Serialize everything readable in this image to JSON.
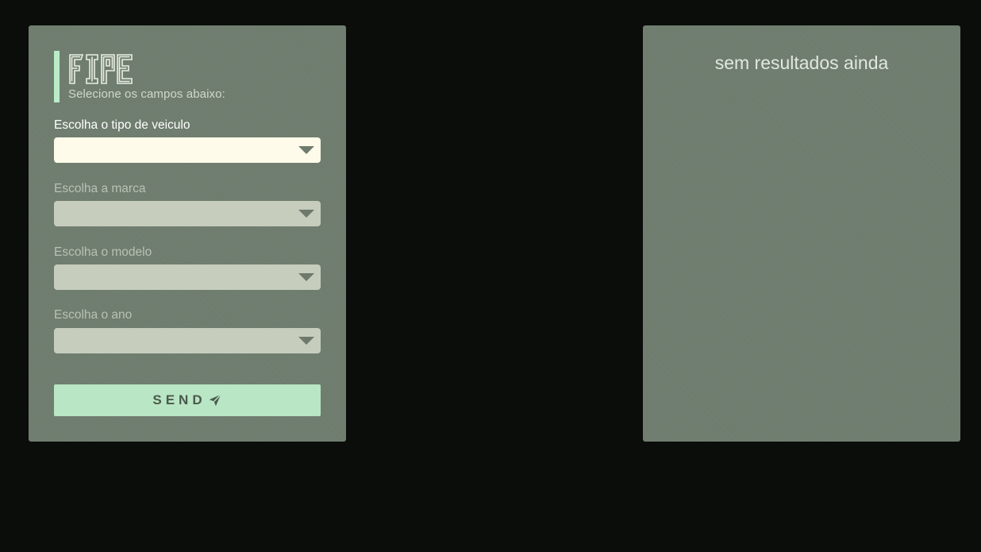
{
  "app": {
    "logo_text": "FIPE",
    "subtitle": "Selecione os campos abaixo:"
  },
  "form": {
    "fields": [
      {
        "label": "Escolha o tipo de veiculo",
        "value": "",
        "enabled": true
      },
      {
        "label": "Escolha a marca",
        "value": "",
        "enabled": false
      },
      {
        "label": "Escolha o modelo",
        "value": "",
        "enabled": false
      },
      {
        "label": "Escolha o ano",
        "value": "",
        "enabled": false
      }
    ],
    "send_label": "SEND",
    "send_icon": "paper-plane-icon",
    "dropdown_icon": "caret-down-icon"
  },
  "results": {
    "empty_text": "sem resultados ainda"
  },
  "colors": {
    "background": "#0b0d0a",
    "panel": "#6e7c6e",
    "accent": "#b9ecc8",
    "button": "#b9e6c4",
    "active_select": "#fffbea",
    "disabled_select": "#c6cdbd"
  }
}
